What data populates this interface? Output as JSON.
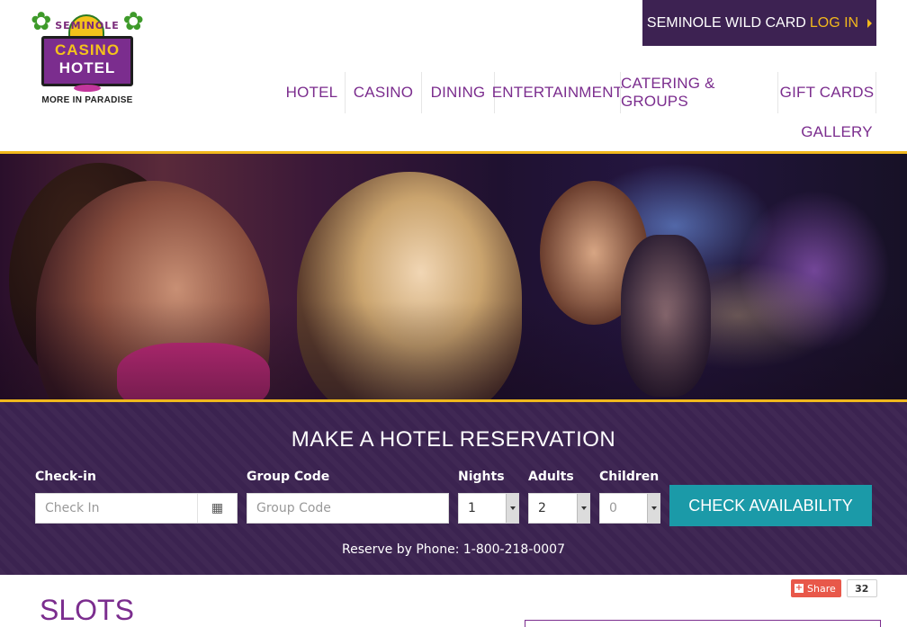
{
  "logo": {
    "top_text": "SEMINOLE",
    "line1": "CASINO",
    "line2": "HOTEL",
    "tagline": "MORE IN PARADISE"
  },
  "wild_card": {
    "label": "SEMINOLE WILD CARD",
    "login": "LOG IN"
  },
  "nav": {
    "items": [
      {
        "label": "HOTEL"
      },
      {
        "label": "CASINO"
      },
      {
        "label": "DINING"
      },
      {
        "label": "ENTERTAINMENT"
      },
      {
        "label": "CATERING & GROUPS"
      },
      {
        "label": "GIFT CARDS"
      },
      {
        "label": "GALLERY"
      }
    ]
  },
  "reservation": {
    "title": "MAKE A HOTEL RESERVATION",
    "checkin_label": "Check-in",
    "checkin_placeholder": "Check In",
    "group_label": "Group Code",
    "group_placeholder": "Group Code",
    "nights_label": "Nights",
    "nights_value": "1",
    "adults_label": "Adults",
    "adults_value": "2",
    "children_label": "Children",
    "children_value": "0",
    "button": "CHECK AVAILABILITY",
    "phone": "Reserve by Phone: 1-800-218-0007"
  },
  "share": {
    "label": "Share",
    "count": "32"
  },
  "page": {
    "title": "SLOTS"
  },
  "colors": {
    "brand_purple": "#7b2d8e",
    "dark_purple": "#3d2252",
    "gold": "#f0b81d",
    "teal_button": "#1b9aa8"
  }
}
